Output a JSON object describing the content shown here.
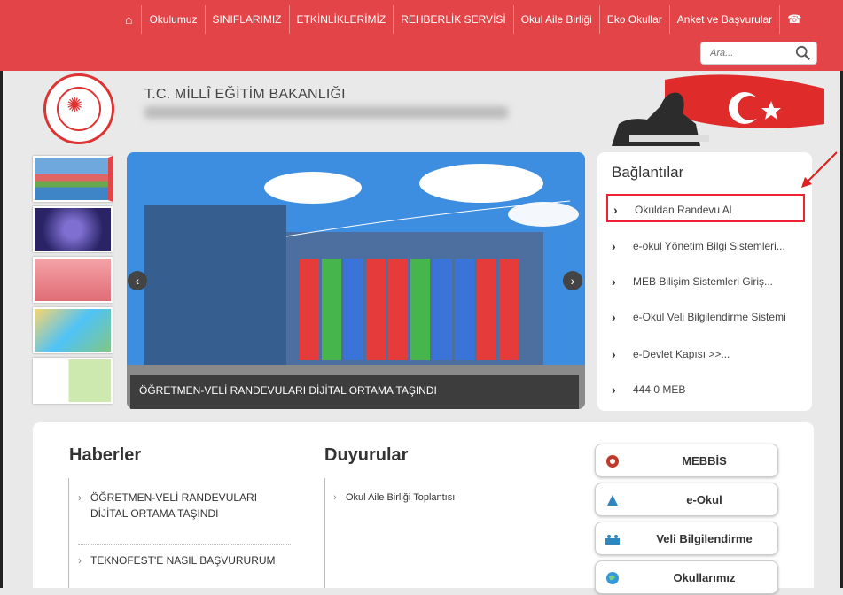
{
  "nav": {
    "home_icon": "home-icon",
    "items": [
      "Okulumuz",
      "SINIFLARIMIZ",
      "ETKİNLİKLERİMİZ",
      "REHBERLİK SERVİSİ",
      "Okul Aile Birliği",
      "Eko Okullar",
      "Anket ve Başvurular"
    ],
    "phone_icon": "phone-icon",
    "search_placeholder": "Ara...",
    "brand_color": "#e34448"
  },
  "header": {
    "ministry": "T.C. MİLLÎ EĞİTİM BAKANLIĞI"
  },
  "slider": {
    "caption": "ÖĞRETMEN-VELİ RANDEVULARI DİJİTAL ORTAMA TAŞINDI",
    "prev": "‹",
    "next": "›",
    "thumb_count": 5
  },
  "links": {
    "title": "Bağlantılar",
    "items": [
      "Okuldan Randevu Al",
      "e-okul Yönetim Bilgi Sistemleri...",
      "MEB Bilişim Sistemleri Giriş...",
      "e-Okul Veli Bilgilendirme Sistemi",
      "e-Devlet Kapısı >>...",
      "444 0 MEB"
    ]
  },
  "news": {
    "title": "Haberler",
    "items": [
      "ÖĞRETMEN-VELİ RANDEVULARI DİJİTAL ORTAMA TAŞINDI",
      "TEKNOFEST'E NASIL BAŞVURURUM"
    ]
  },
  "announcements": {
    "title": "Duyurular",
    "items": [
      "Okul Aile Birliği Toplantısı"
    ]
  },
  "quick_links": [
    "MEBBİS",
    "e-Okul",
    "Veli Bilgilendirme",
    "Okullarımız"
  ]
}
